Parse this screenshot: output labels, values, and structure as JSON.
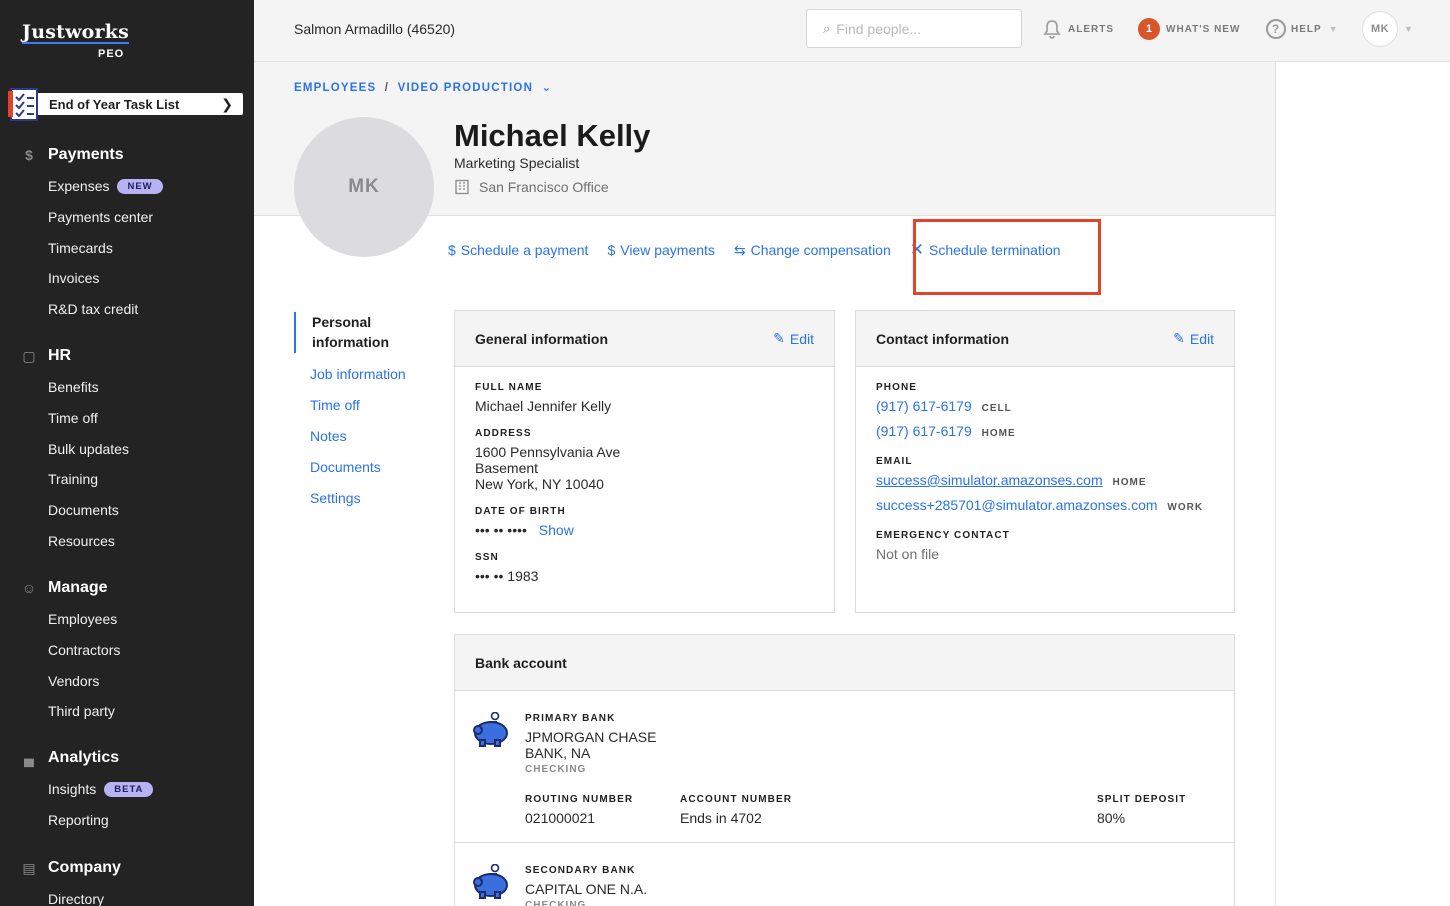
{
  "sidebar": {
    "logo": "Justworks",
    "logo_sub": "PEO",
    "eoy_label": "End of Year Task List",
    "sections": [
      {
        "title": "Payments",
        "icon": "dollar-icon",
        "items": [
          {
            "label": "Expenses",
            "badge": "NEW"
          },
          {
            "label": "Payments center"
          },
          {
            "label": "Timecards"
          },
          {
            "label": "Invoices"
          },
          {
            "label": "R&D tax credit"
          }
        ]
      },
      {
        "title": "HR",
        "icon": "clipboard-icon",
        "items": [
          {
            "label": "Benefits"
          },
          {
            "label": "Time off"
          },
          {
            "label": "Bulk updates"
          },
          {
            "label": "Training"
          },
          {
            "label": "Documents"
          },
          {
            "label": "Resources"
          }
        ]
      },
      {
        "title": "Manage",
        "icon": "people-icon",
        "items": [
          {
            "label": "Employees"
          },
          {
            "label": "Contractors"
          },
          {
            "label": "Vendors"
          },
          {
            "label": "Third party"
          }
        ]
      },
      {
        "title": "Analytics",
        "icon": "bar-chart-icon",
        "items": [
          {
            "label": "Insights",
            "badge": "BETA"
          },
          {
            "label": "Reporting"
          }
        ]
      },
      {
        "title": "Company",
        "icon": "building-icon",
        "items": [
          {
            "label": "Directory"
          }
        ]
      }
    ]
  },
  "topbar": {
    "company": "Salmon Armadillo (46520)",
    "search_placeholder": "Find people...",
    "alerts": "ALERTS",
    "whats_new": "WHAT'S NEW",
    "whats_new_count": "1",
    "help": "HELP",
    "user_initials": "MK"
  },
  "breadcrumb": {
    "root": "EMPLOYEES",
    "sep": "/",
    "dept": "VIDEO PRODUCTION"
  },
  "employee": {
    "initials": "MK",
    "name": "Michael Kelly",
    "title": "Marketing Specialist",
    "office": "San Francisco Office"
  },
  "actions": {
    "schedule_payment": "Schedule a payment",
    "view_payments": "View payments",
    "change_compensation": "Change compensation",
    "schedule_termination": "Schedule termination"
  },
  "tabs": {
    "personal": "Personal information",
    "job": "Job information",
    "time_off": "Time off",
    "notes": "Notes",
    "documents": "Documents",
    "settings": "Settings"
  },
  "general": {
    "title": "General information",
    "edit": "Edit",
    "full_name_label": "FULL NAME",
    "full_name": "Michael Jennifer Kelly",
    "address_label": "ADDRESS",
    "address_1": "1600 Pennsylvania Ave",
    "address_2": "Basement",
    "address_3": "New York, NY 10040",
    "dob_label": "DATE OF BIRTH",
    "dob_masked": "••• •• ••••",
    "show": "Show",
    "ssn_label": "SSN",
    "ssn_masked": "••• •• 1983"
  },
  "contact": {
    "title": "Contact information",
    "edit": "Edit",
    "phone_label": "PHONE",
    "phone_cell": "(917) 617-6179",
    "cell_tag": "CELL",
    "phone_home": "(917) 617-6179",
    "home_tag": "HOME",
    "email_label": "EMAIL",
    "email_home": "success@simulator.amazonses.com",
    "email_home_tag": "HOME",
    "email_work": "success+285701@simulator.amazonses.com",
    "email_work_tag": "WORK",
    "emergency_label": "EMERGENCY CONTACT",
    "emergency_value": "Not on file"
  },
  "bank": {
    "title": "Bank account",
    "primary_label": "PRIMARY BANK",
    "primary_name_1": "JPMORGAN CHASE",
    "primary_name_2": "BANK, NA",
    "primary_type": "CHECKING",
    "routing_label": "ROUTING NUMBER",
    "routing": "021000021",
    "account_label": "ACCOUNT NUMBER",
    "account": "Ends in 4702",
    "split_label": "SPLIT DEPOSIT",
    "split": "80%",
    "secondary_label": "SECONDARY BANK",
    "secondary_name": "CAPITAL ONE N.A.",
    "secondary_type": "CHECKING"
  }
}
